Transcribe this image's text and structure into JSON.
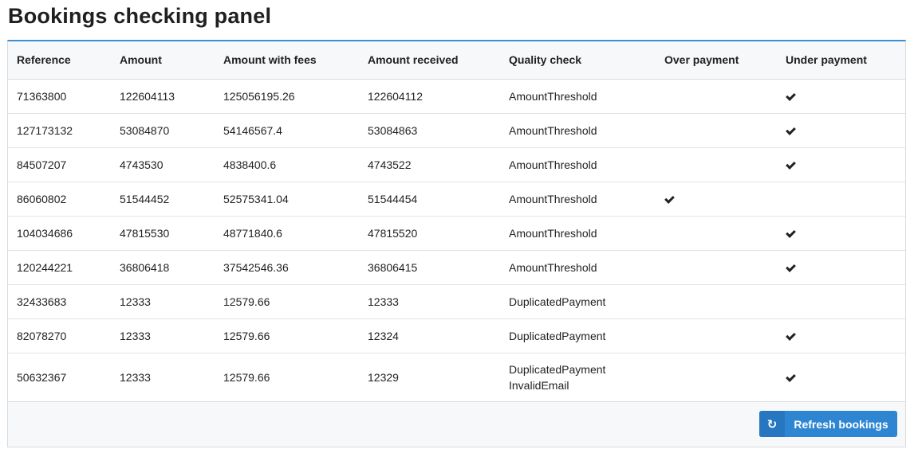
{
  "page": {
    "title": "Bookings checking panel"
  },
  "table": {
    "columns": [
      "Reference",
      "Amount",
      "Amount with fees",
      "Amount received",
      "Quality check",
      "Over payment",
      "Under payment"
    ],
    "rows": [
      {
        "reference": "71363800",
        "amount": "122604113",
        "amount_with_fees": "125056195.26",
        "amount_received": "122604112",
        "quality_check": [
          "AmountThreshold"
        ],
        "over_payment": false,
        "under_payment": true
      },
      {
        "reference": "127173132",
        "amount": "53084870",
        "amount_with_fees": "54146567.4",
        "amount_received": "53084863",
        "quality_check": [
          "AmountThreshold"
        ],
        "over_payment": false,
        "under_payment": true
      },
      {
        "reference": "84507207",
        "amount": "4743530",
        "amount_with_fees": "4838400.6",
        "amount_received": "4743522",
        "quality_check": [
          "AmountThreshold"
        ],
        "over_payment": false,
        "under_payment": true
      },
      {
        "reference": "86060802",
        "amount": "51544452",
        "amount_with_fees": "52575341.04",
        "amount_received": "51544454",
        "quality_check": [
          "AmountThreshold"
        ],
        "over_payment": true,
        "under_payment": false
      },
      {
        "reference": "104034686",
        "amount": "47815530",
        "amount_with_fees": "48771840.6",
        "amount_received": "47815520",
        "quality_check": [
          "AmountThreshold"
        ],
        "over_payment": false,
        "under_payment": true
      },
      {
        "reference": "120244221",
        "amount": "36806418",
        "amount_with_fees": "37542546.36",
        "amount_received": "36806415",
        "quality_check": [
          "AmountThreshold"
        ],
        "over_payment": false,
        "under_payment": true
      },
      {
        "reference": "32433683",
        "amount": "12333",
        "amount_with_fees": "12579.66",
        "amount_received": "12333",
        "quality_check": [
          "DuplicatedPayment"
        ],
        "over_payment": false,
        "under_payment": false
      },
      {
        "reference": "82078270",
        "amount": "12333",
        "amount_with_fees": "12579.66",
        "amount_received": "12324",
        "quality_check": [
          "DuplicatedPayment"
        ],
        "over_payment": false,
        "under_payment": true
      },
      {
        "reference": "50632367",
        "amount": "12333",
        "amount_with_fees": "12579.66",
        "amount_received": "12329",
        "quality_check": [
          "DuplicatedPayment",
          "InvalidEmail"
        ],
        "over_payment": false,
        "under_payment": true
      }
    ]
  },
  "footer": {
    "refresh_label": "Refresh bookings",
    "refresh_icon": "refresh-icon"
  },
  "colors": {
    "accent": "#2e86d3",
    "header_bg": "#f7f8fa",
    "border": "#dcdcdc"
  }
}
